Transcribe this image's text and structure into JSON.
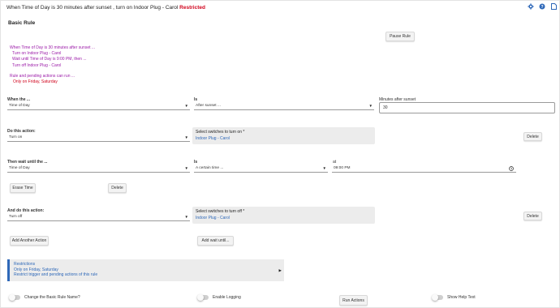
{
  "header": {
    "title": "When Time of Day is 30 minutes after sunset , turn on Indoor Plug - Carol",
    "restricted_label": "Restricted",
    "icons": [
      "gear-icon",
      "help-icon",
      "document-icon"
    ]
  },
  "rule_type": "Basic Rule",
  "pause_button": "Pause Rule",
  "summary": {
    "lines": [
      "When Time of Day is 30 minutes after sunset ...",
      "Turn on Indoor Plug - Carol",
      "Wait until Time of Day is 9:00 PM, then ...",
      "Turn off Indoor Plug - Carol"
    ],
    "pending_line": "Rule and pending actions can run ...",
    "restriction_line": "Only on Friday, Saturday"
  },
  "when": {
    "label": "When the ...",
    "value": "Time of Day",
    "is_label": "Is",
    "is_value": "After sunset ...",
    "minutes_label": "Minutes after sunset",
    "minutes_value": "30"
  },
  "do_action": {
    "label": "Do this action:",
    "value": "Turn on",
    "switches_title": "Select switches to turn on *",
    "switches_value": "Indoor Plug - Carol",
    "delete_label": "Delete"
  },
  "wait": {
    "label": "Then wait until the ...",
    "value": "Time of Day",
    "is_label": "Is",
    "is_value": "A certain time ...",
    "at_label": "at",
    "time_value": "09:00 PM",
    "erase_label": "Erase Time",
    "delete_label": "Delete"
  },
  "and_do": {
    "label": "And do this action:",
    "value": "Turn off",
    "switches_title": "Select switches to turn off *",
    "switches_value": "Indoor Plug - Carol",
    "delete_label": "Delete"
  },
  "add_action_label": "Add Another Action",
  "add_wait_label": "Add wait until...",
  "restrictions": {
    "title": "Restrictions",
    "line1": "Only on Friday, Saturday",
    "line2": "Restrict trigger and pending actions of this rule"
  },
  "footer": {
    "change_name_label": "Change the Basic Rule Name?",
    "logging_label": "Enable Logging",
    "run_actions_label": "Run Actions",
    "help_text_label": "Show Help Text"
  },
  "colors": {
    "accent_blue": "#2e68b8",
    "summary_purple": "#9b1aa8",
    "restricted_red": "#d0021b"
  }
}
